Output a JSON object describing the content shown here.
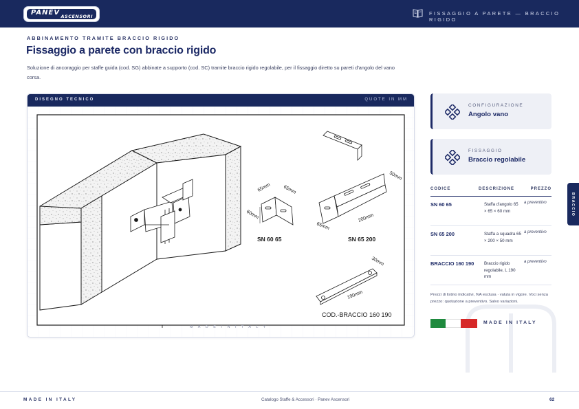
{
  "header": {
    "logo_main": "PANEV",
    "logo_sub": "ASCENSORI",
    "section_title": "FISSAGGIO A PARETE — BRACCIO RIGIDO"
  },
  "intro": {
    "kicker": "ABBINAMENTO TRAMITE BRACCIO RIGIDO",
    "title": "Fissaggio a parete con braccio rigido",
    "lead": "Soluzione di ancoraggio per staffe guida (cod. SG) abbinate a supporto (cod. SC) tramite braccio rigido regolabile, per il fissaggio diretto su pareti d'angolo del vano corsa."
  },
  "drawing": {
    "header_left": "DISEGNO TECNICO",
    "header_right": "QUOTE IN MM",
    "watermark": "M A D E   I N   I T A L Y",
    "labels": {
      "sn6065": "SN 60 65",
      "sn65200": "SN 65 200",
      "braccio": "COD.-BRACCIO 160 190",
      "d65a": "65mm",
      "d65b": "65mm",
      "d60": "60mm",
      "d65c": "65mm",
      "d200": "200mm",
      "d50": "50mm",
      "d30": "30mm",
      "d190": "190mm"
    }
  },
  "config_card": {
    "label": "CONFIGURAZIONE",
    "value": "Angolo vano",
    "icon": "diamond-cluster-icon"
  },
  "fix_card": {
    "label": "FISSAGGIO",
    "value": "Braccio regolabile",
    "icon": "diamond-cluster-icon"
  },
  "table": {
    "headers": [
      "CODICE",
      "DESCRIZIONE",
      "PREZZO"
    ],
    "rows": [
      {
        "code": "SN 60 65",
        "desc": "Staffa d'angolo 65 × 65 × 60 mm",
        "price": "a preventivo"
      },
      {
        "code": "SN 65 200",
        "desc": "Staffa a squadra 65 × 200 × 50 mm",
        "price": "a preventivo"
      },
      {
        "code": "BRACCIO 160 190",
        "desc": "Braccio rigido regolabile, L 190 mm",
        "price": "a preventivo"
      }
    ],
    "note": "Prezzi di listino indicativi, IVA esclusa · valuta in vigore. Voci senza prezzo: quotazione a preventivo. Salvo variazioni."
  },
  "made_in_italy": "MADE IN ITALY",
  "flag_colors": [
    "#1f8a3e",
    "#ffffff",
    "#d62828"
  ],
  "side_tab": "BRACCIO",
  "footer": {
    "left": "MADE IN ITALY",
    "center": "Catalogo Staffe & Accessori · Panev Ascensori",
    "page": "62"
  }
}
